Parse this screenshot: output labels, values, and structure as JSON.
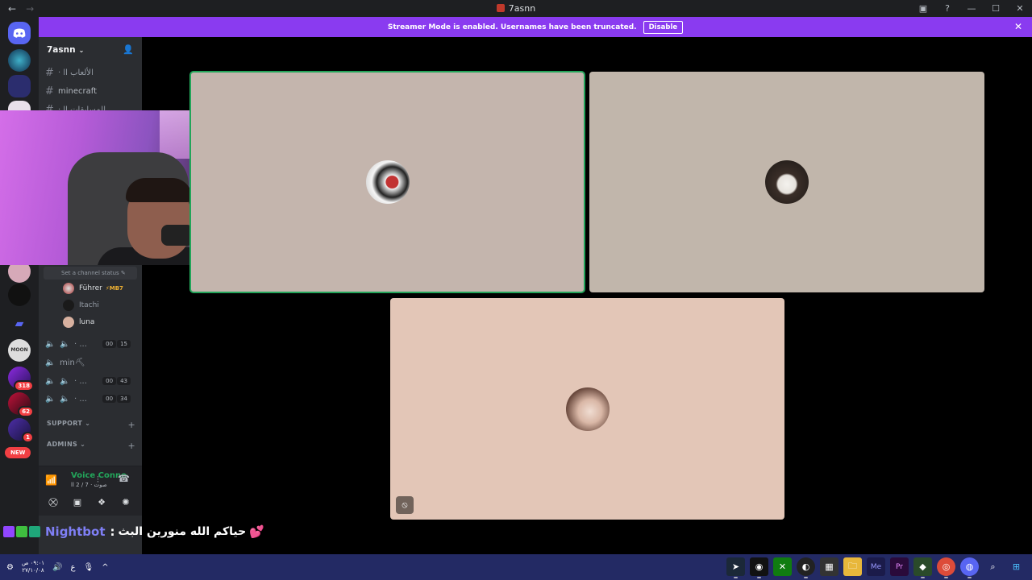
{
  "window": {
    "title": "7asnn",
    "back_glyph": "←",
    "forward_glyph": "→",
    "controls": [
      "▣",
      "?",
      "—",
      "☐",
      "✕"
    ]
  },
  "banner": {
    "text": "Streamer Mode is enabled. Usernames have been truncated.",
    "button": "Disable",
    "close_glyph": "✕"
  },
  "server": {
    "name": "7asnn",
    "chevron": "⌄",
    "invite_glyph": "👤"
  },
  "rail": {
    "badges": [
      "318",
      "62",
      "1"
    ],
    "new_label": "NEW",
    "moon_label": "MOON"
  },
  "channels": {
    "text": [
      {
        "hash": "#",
        "label": "· الألعاب اا"
      },
      {
        "hash": "#",
        "label": "minecraft"
      },
      {
        "hash": "#",
        "label": "· المسابقات اا"
      }
    ]
  },
  "voice": {
    "status_placeholder": "Set a channel status ✎",
    "users": [
      {
        "name": "Führer",
        "tag": "⚡MB7"
      },
      {
        "name": "Itachi",
        "tag": ""
      },
      {
        "name": "luna",
        "tag": ""
      }
    ],
    "luna_icon": "⦸",
    "channels": [
      {
        "label": "· ...",
        "counts": [
          "00",
          "15"
        ]
      },
      {
        "label": "min⛏",
        "counts": []
      },
      {
        "label": "· ...",
        "counts": [
          "00",
          "43"
        ]
      },
      {
        "label": "· ...",
        "counts": [
          "00",
          "34"
        ]
      }
    ]
  },
  "categories": [
    {
      "label": "SUPPORT ⌄",
      "plus": "+"
    },
    {
      "label": "ADMINS ⌄",
      "plus": "+"
    }
  ],
  "voice_panel": {
    "title": "Voice Connected",
    "subtitle": "صوت · 7 / 2 اا",
    "signal_glyph": "📶",
    "wave_glyph": "⫶",
    "hangup_glyph": "☎",
    "buttons": [
      "⛒",
      "▣",
      "❖",
      "✺"
    ]
  },
  "chat_overlay": {
    "bot": "Nightbot",
    "colon": ":",
    "message": "حياكم الله منورين البث",
    "heart": "💕"
  },
  "tiles": {
    "mute_glyph": "⦸"
  },
  "taskbar": {
    "clock_time": "٠٩:٠١ ص",
    "clock_date": "٢٧/١٠/٠٨",
    "tray": [
      "⚙",
      "🔊",
      "ع",
      "🎙",
      "^"
    ],
    "apps": [
      "➤",
      "◉",
      "✕",
      "◐",
      "▦",
      "🗀",
      "Me",
      "Pr",
      "◆",
      "◎",
      "◍",
      "⌕",
      "⊞"
    ]
  },
  "colors": {
    "banner": "#8a3bf0",
    "speaking": "#23a55a",
    "taskbar": "#232a64",
    "tile1": "#c4b5ad",
    "tile2": "#c1b6ab",
    "tile3": "#e3c6b7"
  }
}
